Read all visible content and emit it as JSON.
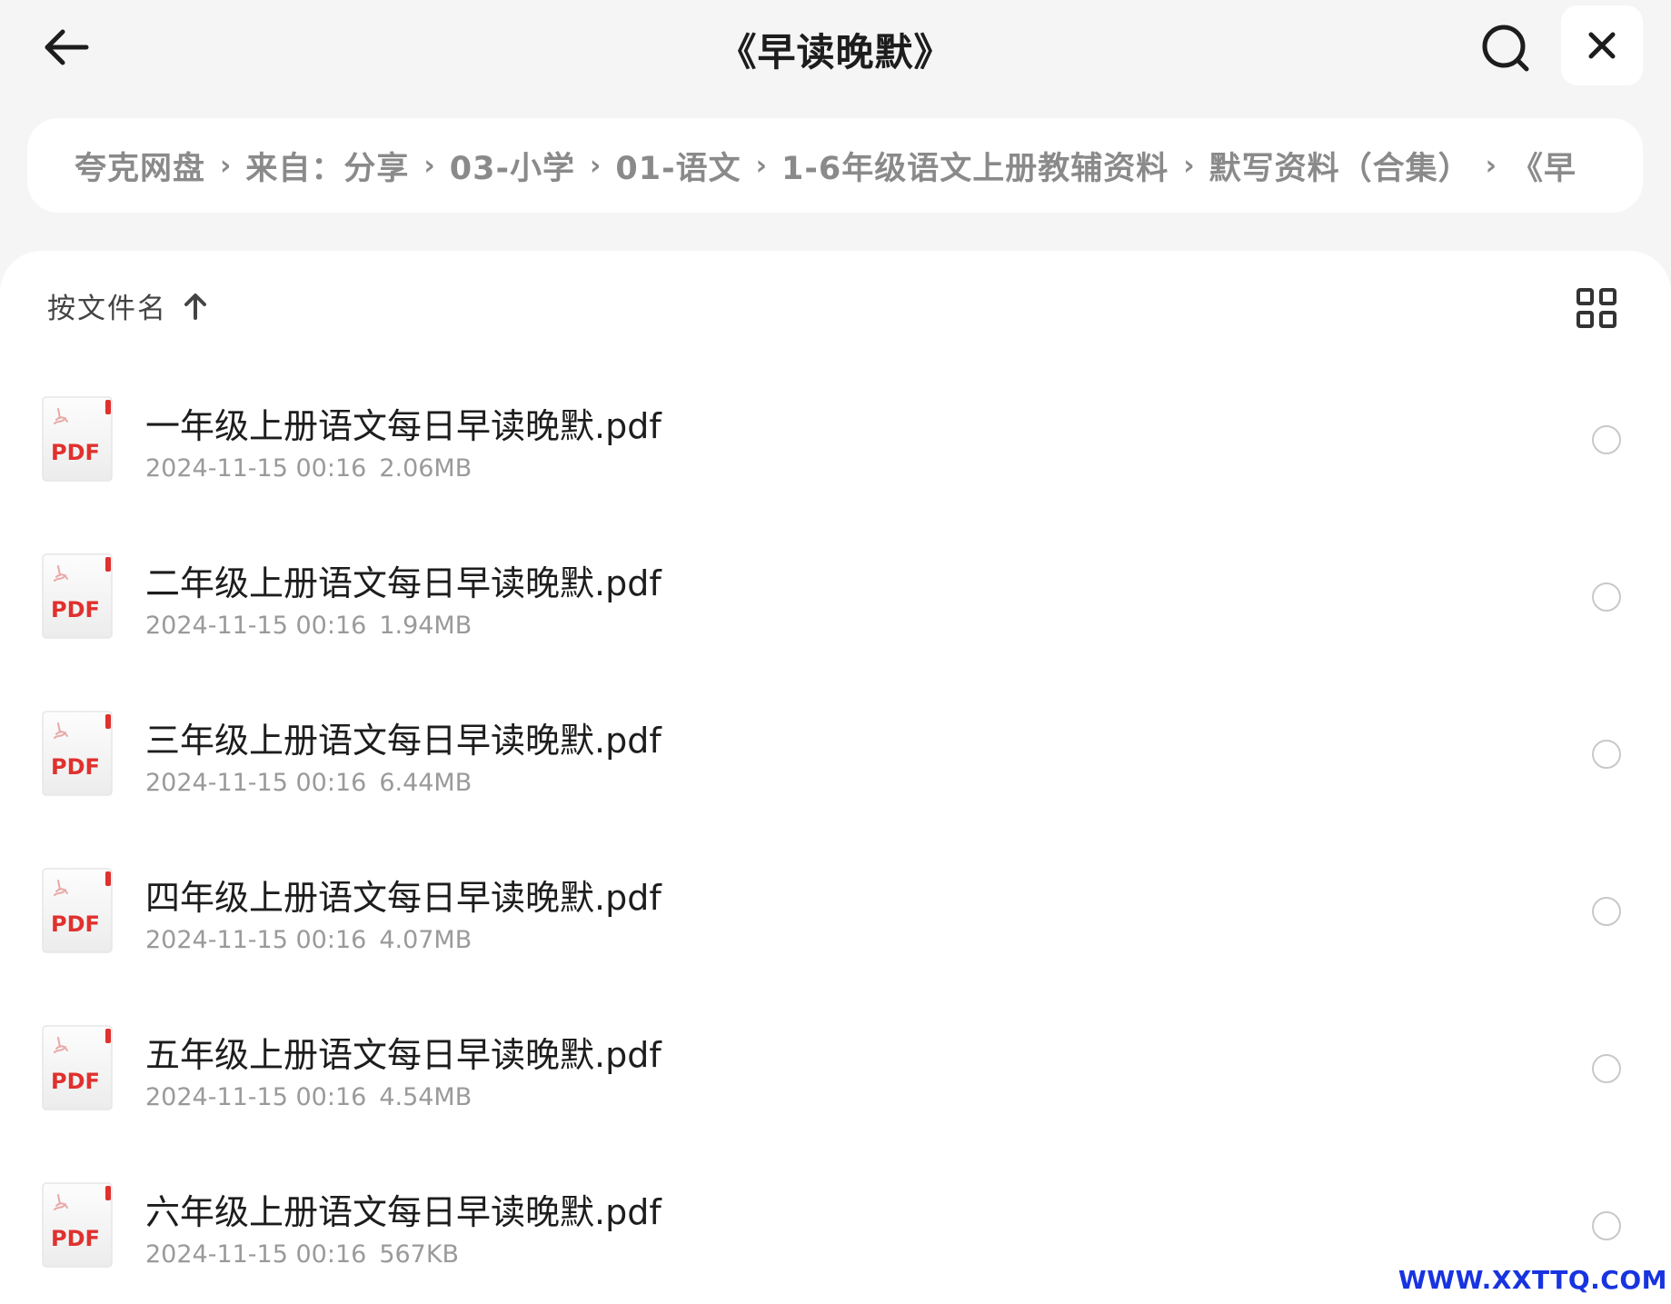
{
  "header": {
    "title": "《早读晚默》"
  },
  "breadcrumb": [
    "夸克网盘",
    "来自：分享",
    "03-小学",
    "01-语文",
    "1-6年级语文上册教辅资料",
    "默写资料（合集）",
    "《早"
  ],
  "sort": {
    "label": "按文件名"
  },
  "files": [
    {
      "name": "一年级上册语文每日早读晚默.pdf",
      "date": "2024-11-15 00:16",
      "size": "2.06MB"
    },
    {
      "name": "二年级上册语文每日早读晚默.pdf",
      "date": "2024-11-15 00:16",
      "size": "1.94MB"
    },
    {
      "name": "三年级上册语文每日早读晚默.pdf",
      "date": "2024-11-15 00:16",
      "size": "6.44MB"
    },
    {
      "name": "四年级上册语文每日早读晚默.pdf",
      "date": "2024-11-15 00:16",
      "size": "4.07MB"
    },
    {
      "name": "五年级上册语文每日早读晚默.pdf",
      "date": "2024-11-15 00:16",
      "size": "4.54MB"
    },
    {
      "name": "六年级上册语文每日早读晚默.pdf",
      "date": "2024-11-15 00:16",
      "size": "567KB"
    }
  ],
  "icons": {
    "back": "arrow-left-icon",
    "search": "search-icon",
    "close": "close-icon",
    "sort": "arrow-up-icon",
    "view": "grid-view-icon",
    "file": "pdf-file-icon"
  },
  "file_type_label": "PDF",
  "colors": {
    "background": "#f5f5f5",
    "panel": "#ffffff",
    "pdf_red": "#e0312e",
    "muted_text": "#9a9a9a",
    "watermark": "#1834e0"
  },
  "watermark": "WWW.XXTTQ.COM"
}
